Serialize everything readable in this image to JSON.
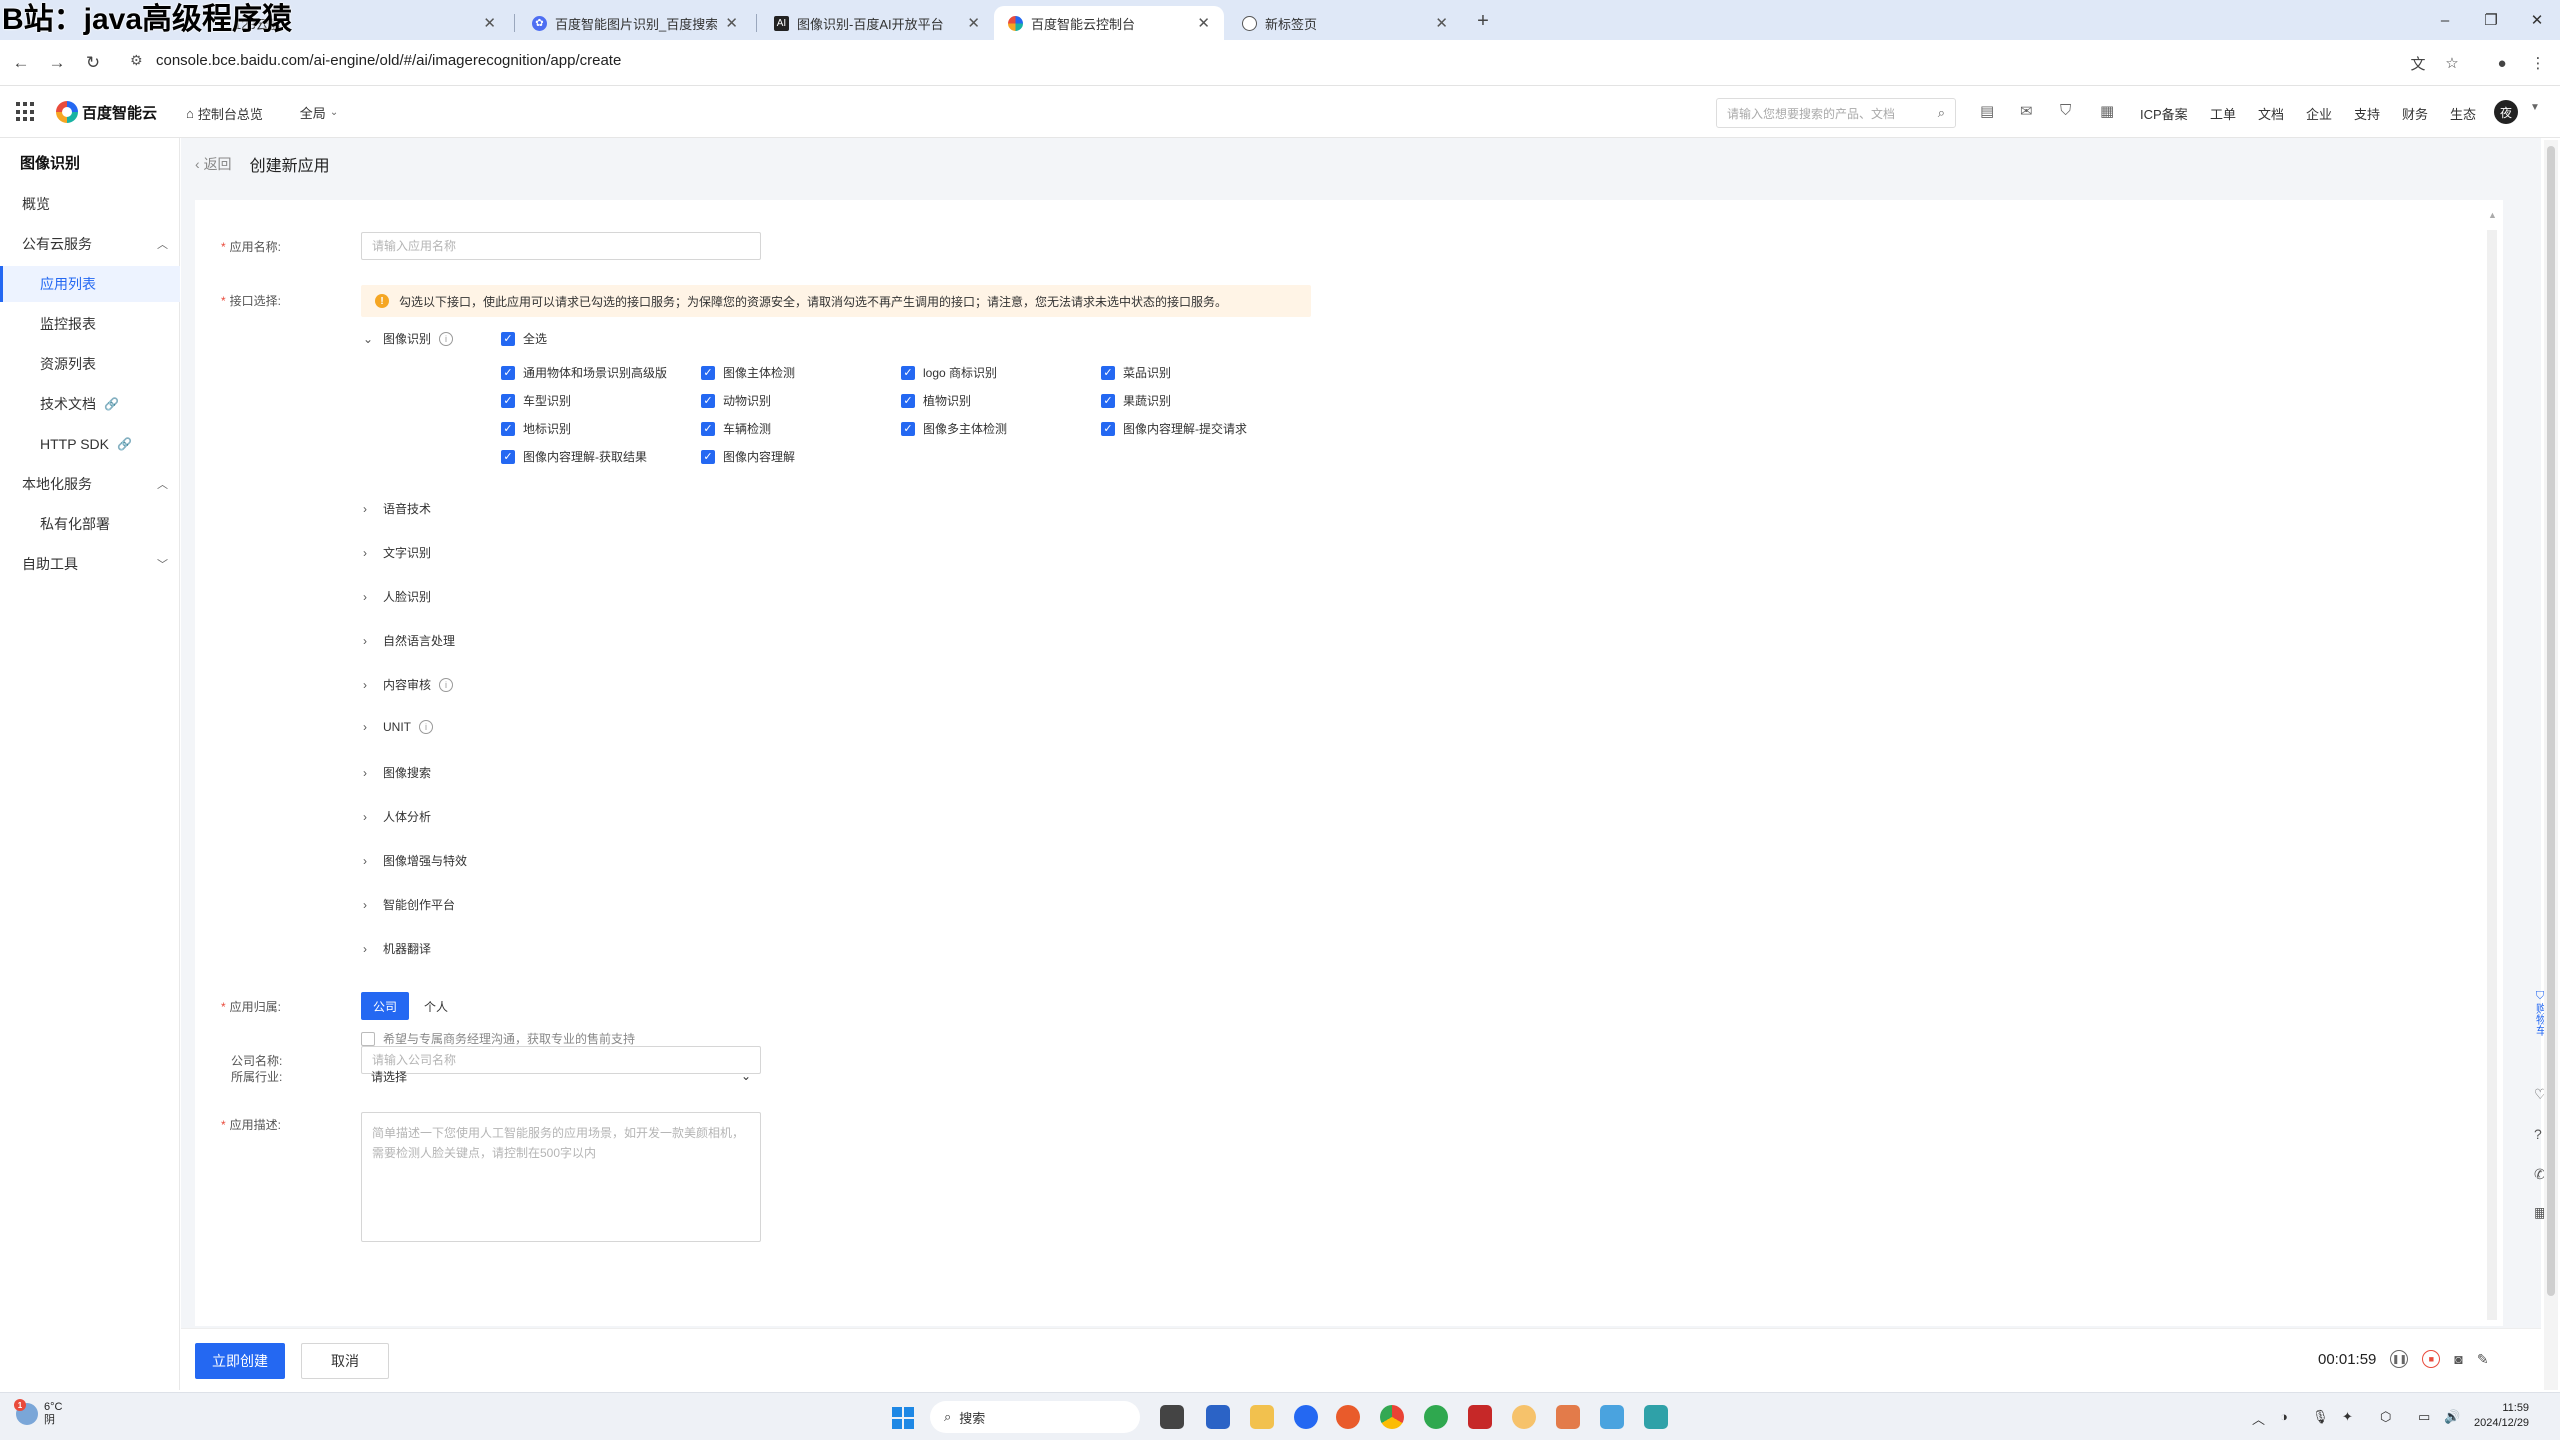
{
  "watermark": "B站：java高级程序猿",
  "browser": {
    "tabs": [
      {
        "title": "123云盘",
        "active": false
      },
      {
        "title": "百度智能图片识别_百度搜索",
        "active": false
      },
      {
        "title": "图像识别-百度AI开放平台",
        "active": false
      },
      {
        "title": "百度智能云控制台",
        "active": true
      },
      {
        "title": "新标签页",
        "active": false
      }
    ],
    "url": "console.bce.baidu.com/ai-engine/old/#/ai/imagerecognition/app/create"
  },
  "topnav": {
    "brand": "百度智能云",
    "home": "控制台总览",
    "region": "全局",
    "search_placeholder": "请输入您想要搜索的产品、文档",
    "links": [
      "ICP备案",
      "工单",
      "文档",
      "企业",
      "支持",
      "财务",
      "生态"
    ],
    "avatar": "夜"
  },
  "sidebar": {
    "title": "图像识别",
    "items": [
      {
        "label": "概览"
      },
      {
        "label": "公有云服务"
      },
      {
        "label": "应用列表"
      },
      {
        "label": "监控报表"
      },
      {
        "label": "资源列表"
      },
      {
        "label": "技术文档"
      },
      {
        "label": "HTTP SDK"
      },
      {
        "label": "本地化服务"
      },
      {
        "label": "私有化部署"
      },
      {
        "label": "自助工具"
      }
    ]
  },
  "page": {
    "back": "返回",
    "title": "创建新应用"
  },
  "form": {
    "app_name_label": "应用名称:",
    "app_name_placeholder": "请输入应用名称",
    "api_label": "接口选择:",
    "notice": "勾选以下接口，使此应用可以请求已勾选的接口服务；为保障您的资源安全，请取消勾选不再产生调用的接口；请注意，您无法请求未选中状态的接口服务。",
    "image_group": "图像识别",
    "select_all": "全选",
    "image_apis": [
      "通用物体和场景识别高级版",
      "图像主体检测",
      "logo 商标识别",
      "菜品识别",
      "车型识别",
      "动物识别",
      "植物识别",
      "果蔬识别",
      "地标识别",
      "车辆检测",
      "图像多主体检测",
      "图像内容理解-提交请求",
      "图像内容理解-获取结果",
      "图像内容理解"
    ],
    "other_groups": [
      "语音技术",
      "文字识别",
      "人脸识别",
      "自然语言处理",
      "内容审核",
      "UNIT",
      "图像搜索",
      "人体分析",
      "图像增强与特效",
      "智能创作平台",
      "机器翻译"
    ],
    "owner_label": "应用归属:",
    "owner_company": "公司",
    "owner_personal": "个人",
    "contact_option": "希望与专属商务经理沟通，获取专业的售前支持",
    "company_label": "公司名称:",
    "company_placeholder": "请输入公司名称",
    "industry_label": "所属行业:",
    "industry_value": "请选择",
    "desc_label": "应用描述:",
    "desc_placeholder": "简单描述一下您使用人工智能服务的应用场景，如开发一款美颜相机，需要检测人脸关键点，请控制在500字以内",
    "create_button": "立即创建",
    "cancel_button": "取消"
  },
  "recorder": {
    "time": "00:01:59"
  },
  "rail": {
    "cart": "购物车"
  },
  "taskbar": {
    "temp": "6°C",
    "weather": "阴",
    "weather_badge": "1",
    "search": "搜索",
    "time": "11:59",
    "date": "2024/12/29"
  }
}
